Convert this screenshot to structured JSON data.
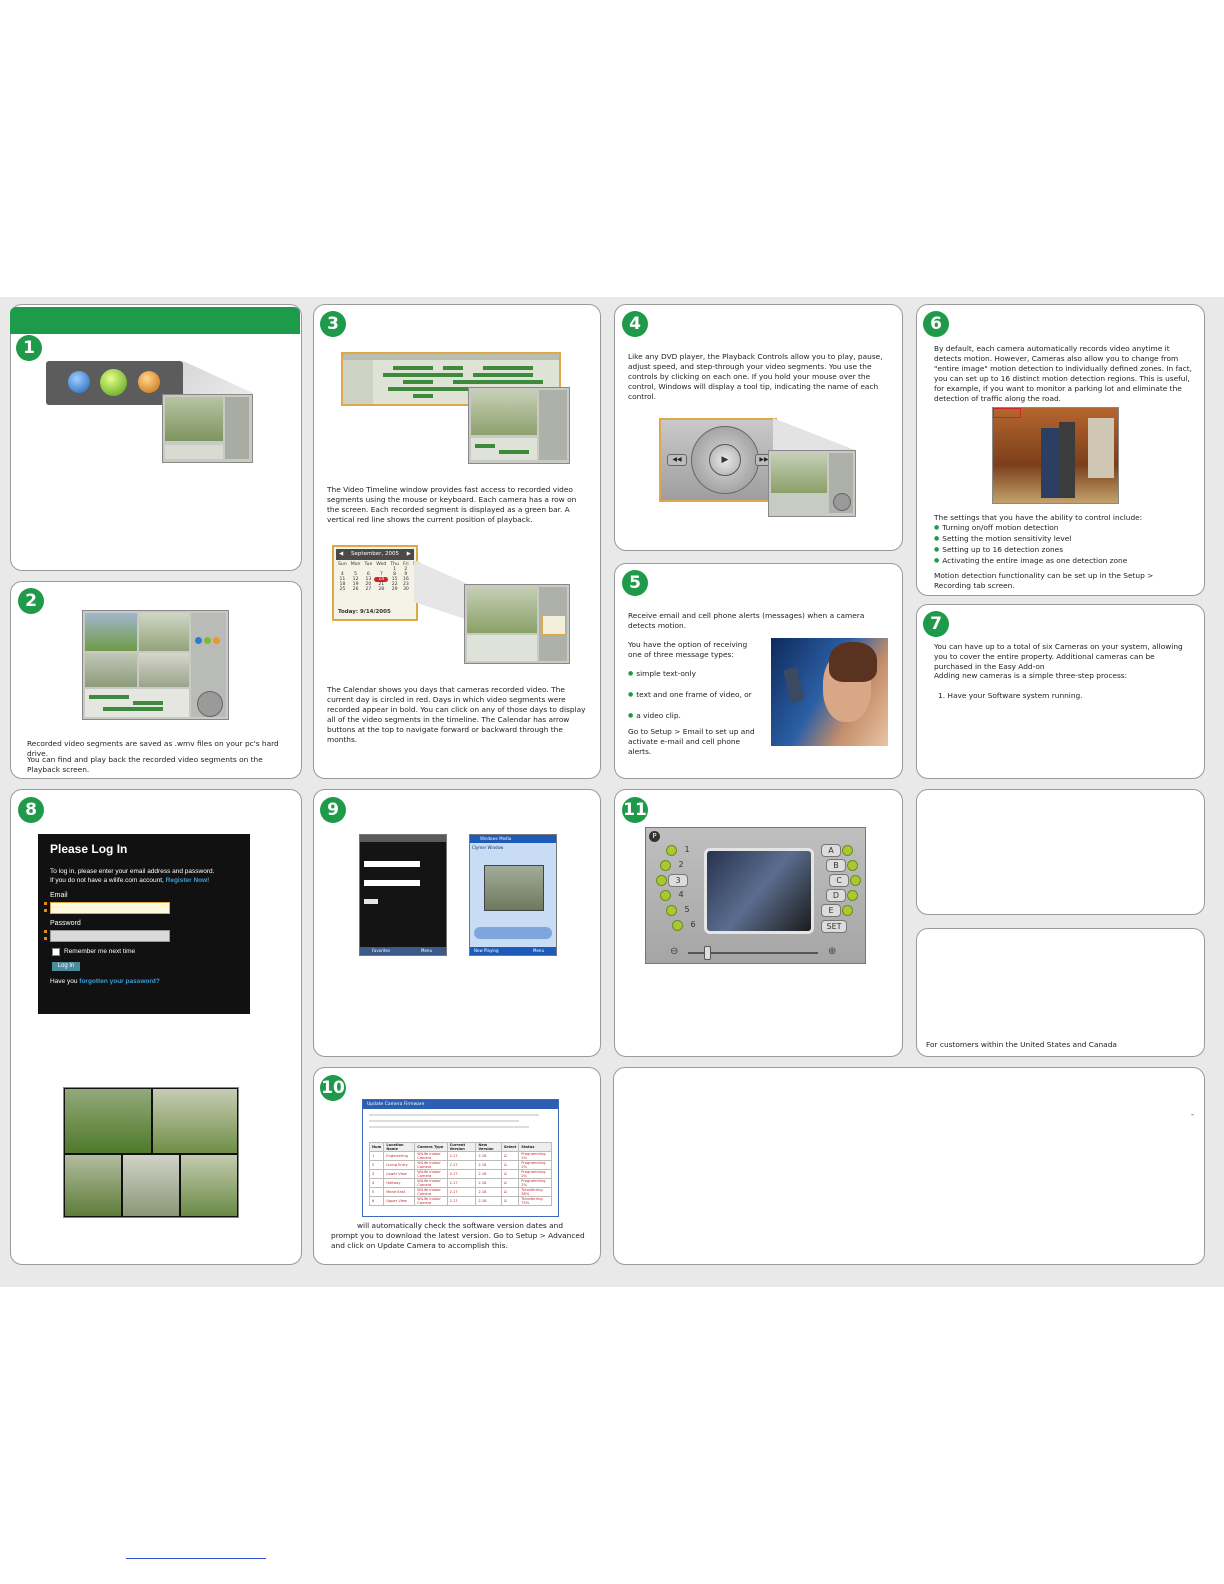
{
  "panels": {
    "p1": {
      "number": "1"
    },
    "p2": {
      "number": "2",
      "text1": "Recorded video segments are saved as .wmv files on your pc's hard drive.",
      "text2": "You can find and play back the recorded video segments on the Playback screen."
    },
    "p3": {
      "number": "3",
      "timeline_text": "The Video Timeline window provides fast access to recorded video segments using the mouse or keyboard. Each camera has a row on the screen. Each recorded segment is displayed as a green bar. A vertical red line shows the current position of playback.",
      "calendar_text": "The Calendar shows you days that cameras recorded video. The current day is circled in red. Days in which video segments were recorded appear in bold. You can click on any of those days to display all of the video segments in the timeline. The Calendar has arrow buttons at the top to navigate forward or backward through the months.",
      "calendar": {
        "month": "September, 2005",
        "today": "Today: 9/14/2005",
        "days": [
          "Sun",
          "Mon",
          "Tue",
          "Wed",
          "Thu",
          "Fri",
          "Sat"
        ],
        "weeks": [
          [
            "",
            "",
            "",
            "",
            "1",
            "2",
            "3"
          ],
          [
            "4",
            "5",
            "6",
            "7",
            "8",
            "9",
            "10"
          ],
          [
            "11",
            "12",
            "13",
            "14",
            "15",
            "16",
            "17"
          ],
          [
            "18",
            "19",
            "20",
            "21",
            "22",
            "23",
            "24"
          ],
          [
            "25",
            "26",
            "27",
            "28",
            "29",
            "30",
            ""
          ]
        ]
      }
    },
    "p4": {
      "number": "4",
      "text": "Like any DVD player, the Playback Controls allow you to play, pause, adjust speed, and step-through your video segments. You use the controls by clicking on each one.  If you hold your mouse over the control, Windows will display a tool tip, indicating the name of each control."
    },
    "p5": {
      "number": "5",
      "intro": "Receive email and cell phone alerts (messages) when a camera detects motion.",
      "option": "You have the option of receiving one of three message types:",
      "types": [
        "simple text-only",
        "text and one frame of video, or",
        "a video clip."
      ],
      "footer": "Go to Setup > Email to set up and activate e-mail and cell phone alerts."
    },
    "p6": {
      "number": "6",
      "intro": "By default, each camera automatically records video anytime it detects motion. However,           Cameras also allow you to change from \"entire image\" motion detection to individually defined zones.  In fact, you can set up to 16 distinct motion detection regions. This is useful, for example, if you want to monitor a parking lot and eliminate the detection of traffic along the road.",
      "settings_intro": "The settings that you have the ability to control include:",
      "settings": [
        "Turning on/off motion detection",
        "Setting the motion sensitivity level",
        "Setting up to 16 detection zones",
        "Activating the entire image as one detection zone"
      ],
      "footer": "Motion detection functionality can be set up in the Setup > Recording tab screen."
    },
    "p7": {
      "number": "7",
      "text": "You can have up to a total of six           Cameras on your system, allowing you to cover the entire property. Additional cameras can be purchased in the Easy Add-on",
      "text2": "Adding new cameras is a simple three-step process:",
      "step1": "1. Have your            Software system running."
    },
    "p8": {
      "number": "8",
      "login": {
        "title": "Please Log In",
        "desc1": "To log in, please enter your email address and password.",
        "desc2": "If you do not have a wilife.com account,",
        "register": "Register Now!",
        "email_label": "Email",
        "password_label": "Password",
        "remember": "Remember me next time",
        "button": "Log In",
        "forgot_prefix": "Have you",
        "forgot_link": "forgotten your password?"
      }
    },
    "p9": {
      "number": "9",
      "phone2_title": "Windows Media",
      "phone2_sub": "Clymer Window",
      "phone2_left": "Now Playing",
      "phone2_right": "Menu",
      "phone1_left": "Favorites",
      "phone1_right": "Menu"
    },
    "p10": {
      "number": "10",
      "window_title": "Update Camera Firmware",
      "columns": [
        "Num",
        "Location Name",
        "Camera Type",
        "Current Version",
        "New Version",
        "Select",
        "Status"
      ],
      "rows": [
        [
          "1",
          "Engineering",
          "WiLife Indoor Camera",
          "2.17",
          "2.18",
          "Programming 2%"
        ],
        [
          "2",
          "Living Entry",
          "WiLife Indoor Camera",
          "2.17",
          "2.18",
          "Programming 2%"
        ],
        [
          "3",
          "Lower View",
          "WiLife Indoor Camera",
          "2.17",
          "2.18",
          "Programming 2%"
        ],
        [
          "4",
          "Hallway",
          "WiLife Indoor Camera",
          "2.17",
          "2.18",
          "Programming 2%"
        ],
        [
          "5",
          "Mane East",
          "WiLife Indoor Camera",
          "2.17",
          "2.18",
          "Transferring 38%"
        ],
        [
          "6",
          "Upper View",
          "WiLife Indoor Camera",
          "2.17",
          "2.18",
          "Transferring 75%"
        ]
      ],
      "text": "will automatically check the software version dates and prompt you to download the latest version.   Go to Setup > Advanced and click on Update Camera to accomplish this."
    },
    "p11": {
      "number": "11",
      "keys_left": [
        "1",
        "2",
        "3",
        "4",
        "5",
        "6"
      ],
      "keys_right": [
        "A",
        "B",
        "C",
        "D",
        "E"
      ],
      "set": "SET"
    },
    "contact": {
      "text": "For customers within the United States and Canada"
    },
    "bottom": {
      "mark": "-"
    }
  }
}
